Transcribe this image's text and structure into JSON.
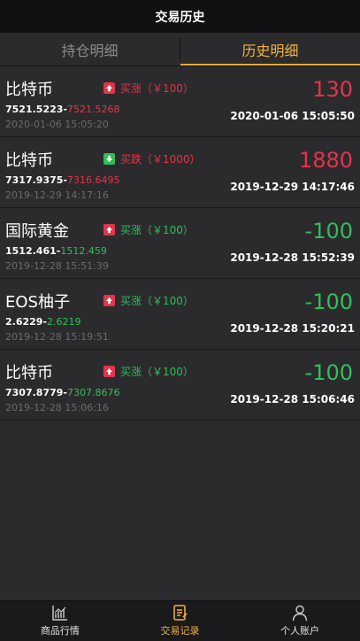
{
  "header": {
    "title": "交易历史"
  },
  "tabs": [
    {
      "label": "持仓明细",
      "active": false
    },
    {
      "label": "历史明细",
      "active": true
    }
  ],
  "records": [
    {
      "name": "比特币",
      "direction": "up",
      "direction_label": "买涨（￥100）",
      "direction_color": "red",
      "open_price": "7521.5223",
      "close_price": "7521.5268",
      "close_price_color": "red",
      "open_time": "2020-01-06 15:05:20",
      "profit": "130",
      "profit_color": "red",
      "close_time": "2020-01-06 15:05:50"
    },
    {
      "name": "比特币",
      "direction": "down",
      "direction_label": "买跌（￥1000）",
      "direction_color": "red",
      "open_price": "7317.9375",
      "close_price": "7316.6495",
      "close_price_color": "red",
      "open_time": "2019-12-29 14:17:16",
      "profit": "1880",
      "profit_color": "red",
      "close_time": "2019-12-29 14:17:46"
    },
    {
      "name": "国际黄金",
      "direction": "up",
      "direction_label": "买涨（￥100）",
      "direction_color": "green",
      "open_price": "1512.461",
      "close_price": "1512.459",
      "close_price_color": "green",
      "open_time": "2019-12-28 15:51:39",
      "profit": "-100",
      "profit_color": "green",
      "close_time": "2019-12-28 15:52:39"
    },
    {
      "name": "EOS柚子",
      "direction": "up",
      "direction_label": "买涨（￥100）",
      "direction_color": "green",
      "open_price": "2.6229",
      "close_price": "2.6219",
      "close_price_color": "green",
      "open_time": "2019-12-28 15:19:51",
      "profit": "-100",
      "profit_color": "green",
      "close_time": "2019-12-28 15:20:21"
    },
    {
      "name": "比特币",
      "direction": "up",
      "direction_label": "买涨（￥100）",
      "direction_color": "green",
      "open_price": "7307.8779",
      "close_price": "7307.8676",
      "close_price_color": "green",
      "open_time": "2019-12-28 15:06:16",
      "profit": "-100",
      "profit_color": "green",
      "close_time": "2019-12-28 15:06:46"
    }
  ],
  "bottom_nav": [
    {
      "label": "商品行情",
      "icon": "chart-icon",
      "active": false
    },
    {
      "label": "交易记录",
      "icon": "document-icon",
      "active": true
    },
    {
      "label": "个人账户",
      "icon": "user-icon",
      "active": false
    }
  ],
  "colors": {
    "red": "#e5334b",
    "green": "#2fbf5b",
    "accent": "#f3b23a",
    "background": "#2b2b2d"
  }
}
